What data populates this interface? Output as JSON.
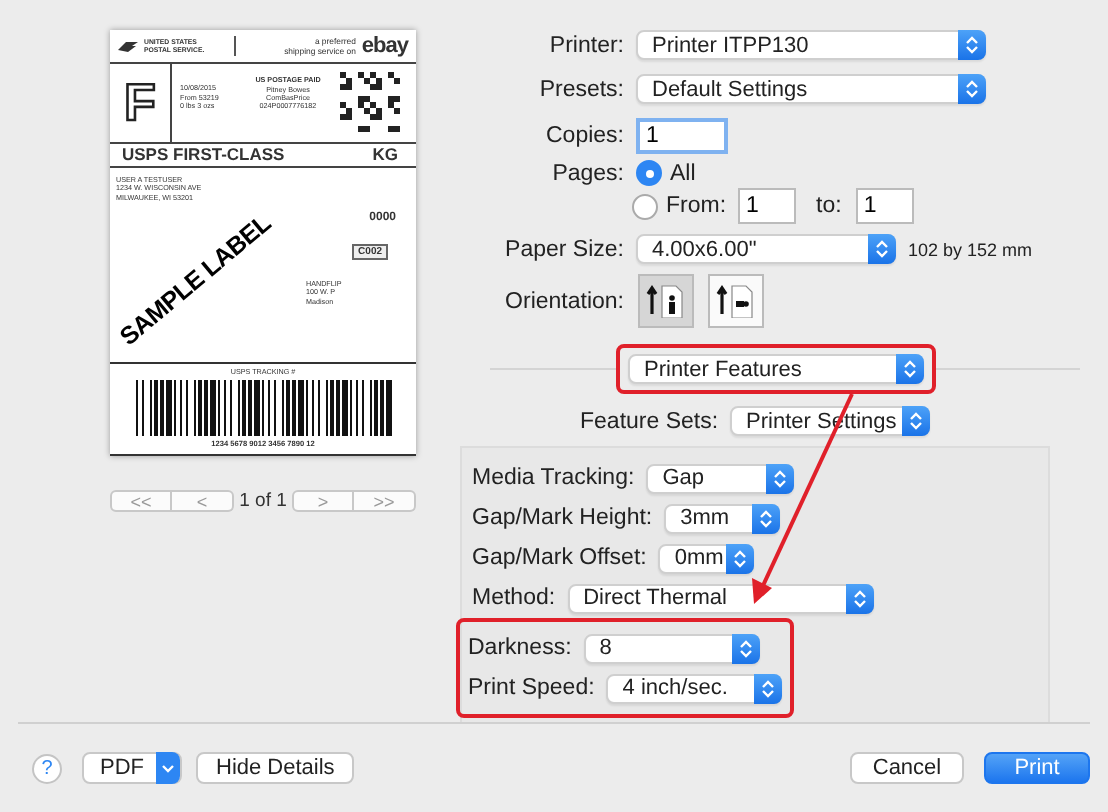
{
  "preview": {
    "document": {
      "carrier": [
        "UNITED STATES",
        "POSTAL SERVICE."
      ],
      "tagline": [
        "a preferred",
        "shipping service on"
      ],
      "brand": "ebay",
      "service_letter": "F",
      "meta": [
        "10/08/2015",
        "From 53219",
        "0 lbs 3 ozs"
      ],
      "postage": [
        "US POSTAGE PAID",
        "Pitney Bowes",
        "ComBasPrice",
        "024P0007776182"
      ],
      "service": [
        "USPS FIRST-CLASS",
        "KG"
      ],
      "sender": [
        "USER A TESTUSER",
        "1234 W. WISCONSIN AVE",
        "MILWAUKEE, WI 53201"
      ],
      "code": "0000",
      "route": "C002",
      "recipient": [
        "HANDFLIP",
        "100 W. P",
        "Madison"
      ],
      "tracking_title": "USPS TRACKING #",
      "tracking_number": "1234 5678 9012 3456 7890 12",
      "stamp": "SAMPLE LABEL"
    },
    "pager": {
      "first": "<<",
      "prev": "<",
      "page": "1 of 1",
      "next": ">",
      "last": ">>"
    }
  },
  "printer": {
    "label": "Printer:",
    "value": "Printer ITPP130"
  },
  "presets": {
    "label": "Presets:",
    "value": "Default Settings"
  },
  "copies": {
    "label": "Copies:",
    "value": "1",
    "focused": true
  },
  "pages": {
    "label": "Pages:",
    "options": [
      {
        "label": "All",
        "selected": true
      },
      {
        "label": "From:",
        "selected": false
      }
    ],
    "from": "1",
    "to_label": "to:",
    "to": "1"
  },
  "paper_size": {
    "label": "Paper Size:",
    "value": "4.00x6.00\"",
    "note": "102 by 152 mm"
  },
  "orientation": {
    "label": "Orientation:",
    "options": [
      {
        "kind": "portrait",
        "selected": true
      },
      {
        "kind": "landscape",
        "selected": false
      }
    ]
  },
  "section_menu": {
    "value": "Printer Features",
    "highlighted": true
  },
  "feature_sets": {
    "label": "Feature Sets:",
    "value": "Printer Settings"
  },
  "features": [
    {
      "label": "Media Tracking:",
      "value": "Gap",
      "highlighted": false
    },
    {
      "label": "Gap/Mark Height:",
      "value": "3mm",
      "highlighted": false
    },
    {
      "label": "Gap/Mark Offset:",
      "value": "0mm",
      "highlighted": false
    },
    {
      "label": "Method:",
      "value": "Direct Thermal",
      "highlighted": false
    },
    {
      "label": "Darkness:",
      "value": "8",
      "highlighted": true
    },
    {
      "label": "Print Speed:",
      "value": "4 inch/sec.",
      "highlighted": true
    }
  ],
  "annotation_arrow": true,
  "footer": {
    "help": "?",
    "pdf": "PDF",
    "details": "Hide Details",
    "cancel": "Cancel",
    "print": "Print"
  }
}
